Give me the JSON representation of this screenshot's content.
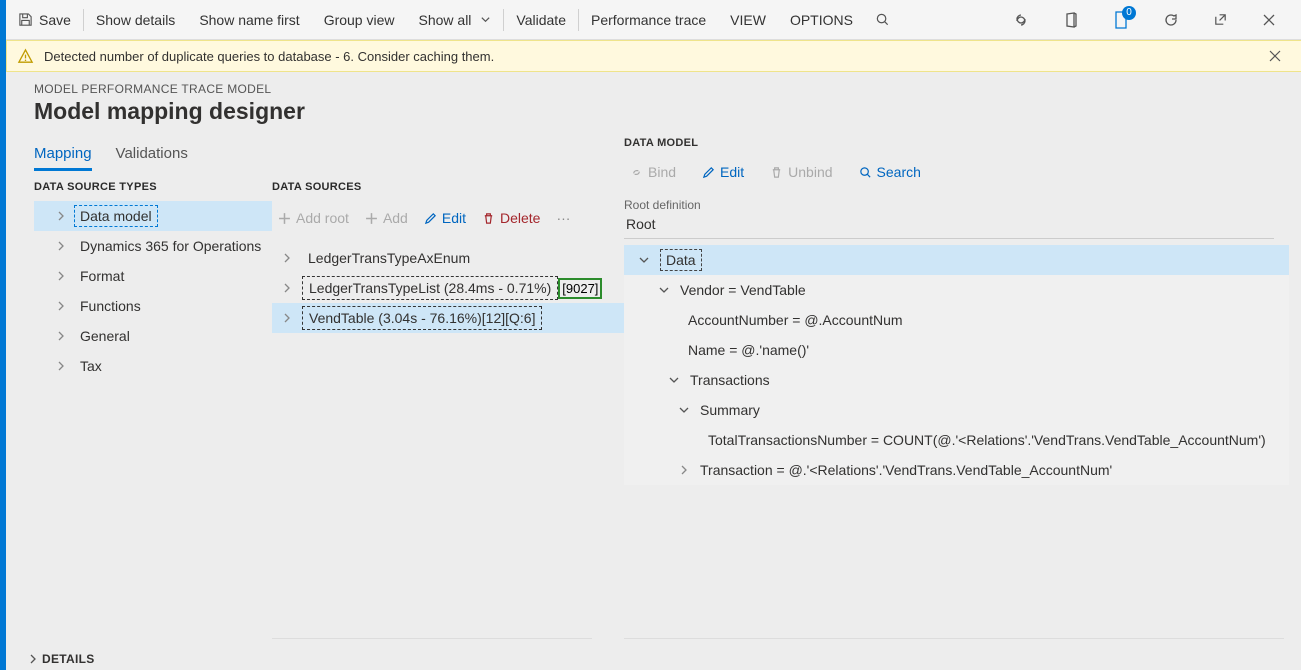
{
  "toolbar": {
    "save": "Save",
    "show_details": "Show details",
    "show_name_first": "Show name first",
    "group_view": "Group view",
    "show_all": "Show all",
    "validate": "Validate",
    "performance_trace": "Performance trace",
    "view": "VIEW",
    "options": "OPTIONS",
    "doc_badge": "0"
  },
  "warning": "Detected number of duplicate queries to database - 6. Consider caching them.",
  "breadcrumb": "MODEL PERFORMANCE TRACE MODEL",
  "page_title": "Model mapping designer",
  "tabs": {
    "mapping": "Mapping",
    "validations": "Validations"
  },
  "dst_head": "DATA SOURCE TYPES",
  "dst_items": [
    "Data model",
    "Dynamics 365 for Operations",
    "Format",
    "Functions",
    "General",
    "Tax"
  ],
  "ds_head": "DATA SOURCES",
  "ds_btns": {
    "add_root": "Add root",
    "add": "Add",
    "edit": "Edit",
    "delete": "Delete",
    "more": "···"
  },
  "ds_items": [
    {
      "label": "LedgerTransTypeAxEnum",
      "trailer": ""
    },
    {
      "label": "LedgerTransTypeList (28.4ms - 0.71%)",
      "trailer": "[9027]",
      "green": true
    },
    {
      "label": "VendTable (3.04s - 76.16%)[12][Q:6]",
      "trailer": "",
      "sel": true
    }
  ],
  "dm_head": "DATA MODEL",
  "dm_btns": {
    "bind": "Bind",
    "edit": "Edit",
    "unbind": "Unbind",
    "search": "Search"
  },
  "root_def_label": "Root definition",
  "root_def_value": "Root",
  "dm_tree": {
    "data": "Data",
    "vendor": "Vendor = VendTable",
    "acct": "AccountNumber = @.AccountNum",
    "name": "Name = @.'name()'",
    "trans": "Transactions",
    "summary": "Summary",
    "ttn": "TotalTransactionsNumber = COUNT(@.'<Relations'.'VendTrans.VendTable_AccountNum')",
    "transaction": "Transaction = @.'<Relations'.'VendTrans.VendTable_AccountNum'"
  },
  "details": "DETAILS"
}
